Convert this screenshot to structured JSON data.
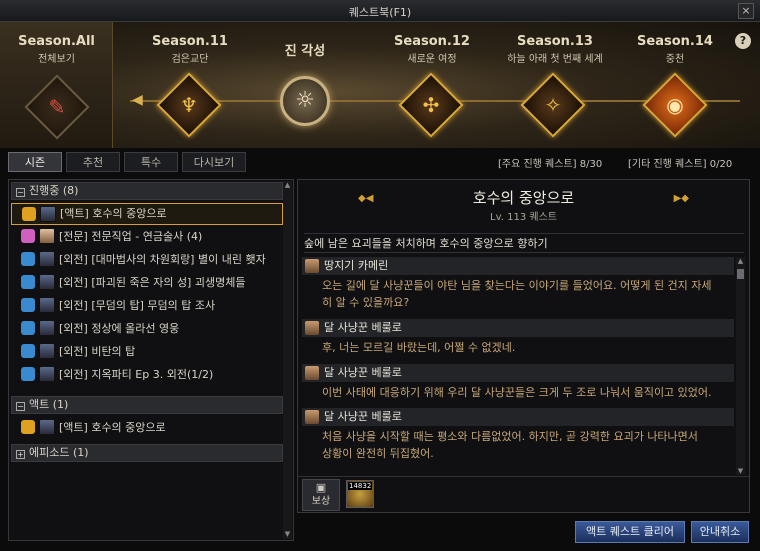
{
  "window": {
    "title": "퀘스트북(F1)",
    "close_label": "×"
  },
  "banner": {
    "seasons": [
      {
        "label": "Season.All",
        "sub": "전체보기"
      },
      {
        "label": "Season.11",
        "sub": "검은교단"
      },
      {
        "label": "진 각성",
        "sub": ""
      },
      {
        "label": "Season.12",
        "sub": "새로운 여정"
      },
      {
        "label": "Season.13",
        "sub": "하늘 아래 첫 번째 세계"
      },
      {
        "label": "Season.14",
        "sub": "중천"
      }
    ],
    "help_label": "?",
    "left_arrow": "◀"
  },
  "tabs": [
    {
      "label": "시즌",
      "active": true
    },
    {
      "label": "추천",
      "active": false
    },
    {
      "label": "특수",
      "active": false
    },
    {
      "label": "다시보기",
      "active": false
    }
  ],
  "counts": {
    "main": "[주요 진행 퀘스트] 8/30",
    "other": "[기타 진행 퀘스트] 0/20"
  },
  "quest_list": {
    "groups": [
      {
        "header": "진행중 (8)",
        "toggle": "−",
        "items": [
          {
            "text": "[액트] 호수의 중앙으로",
            "selected": true
          },
          {
            "text": "[전문] 전문직업 - 연금술사 (4)",
            "selected": false
          },
          {
            "text": "[외전] [대마법사의 차원회랑] 별이 내린 횃자",
            "selected": false
          },
          {
            "text": "[외전] [파괴된 죽은 자의 성] 괴생명체들",
            "selected": false
          },
          {
            "text": "[외전] [무덤의 탑] 무덤의 탑 조사",
            "selected": false
          },
          {
            "text": "[외전] 정상에 올라선 영웅",
            "selected": false
          },
          {
            "text": "[외전] 비탄의 탑",
            "selected": false
          },
          {
            "text": "[외전] 지옥파티 Ep 3. 외전(1/2)",
            "selected": false
          }
        ]
      },
      {
        "header": "액트 (1)",
        "toggle": "−",
        "items": [
          {
            "text": "[액트] 호수의 중앙으로",
            "selected": false
          }
        ]
      },
      {
        "header": "에피소드 (1)",
        "toggle": "+",
        "items": []
      }
    ]
  },
  "detail": {
    "title": "호수의 중앙으로",
    "subtitle": "Lv. 113 퀘스트",
    "summary": "숲에 남은 요괴들을 처치하며 호수의 중앙으로 향하기",
    "dialogs": [
      {
        "speaker": "땅지기 카메린",
        "text": "오는 길에 달 사냥꾼들이 야탄 님을 찾는다는 이야기를 들었어요. 어떻게 된 건지 자세\n히 알 수 있을까요?"
      },
      {
        "speaker": "달 사냥꾼 베룰로",
        "text": "후, 너는 모르길 바랐는데, 어쩔 수 없겠네."
      },
      {
        "speaker": "달 사냥꾼 베룰로",
        "text": "이번 사태에 대응하기 위해 우리 달 사냥꾼들은 크게 두 조로 나눠서 움직이고 있었어."
      },
      {
        "speaker": "달 사냥꾼 베룰로",
        "text": "처음 사냥을 시작할 때는 평소와 다름없었어. 하지만, 곧 강력한 요괴가 나타나면서\n상황이 완전히 뒤집혔어."
      }
    ],
    "reward_label": "보상",
    "reward_item_count": "14832"
  },
  "buttons": {
    "clear": "액트 퀘스트 클리어",
    "cancel": "안내취소"
  },
  "colors": {
    "accent_gold": "#d8a030",
    "button_blue": "#2a4a8a",
    "dialog_text": "#c8a878"
  }
}
